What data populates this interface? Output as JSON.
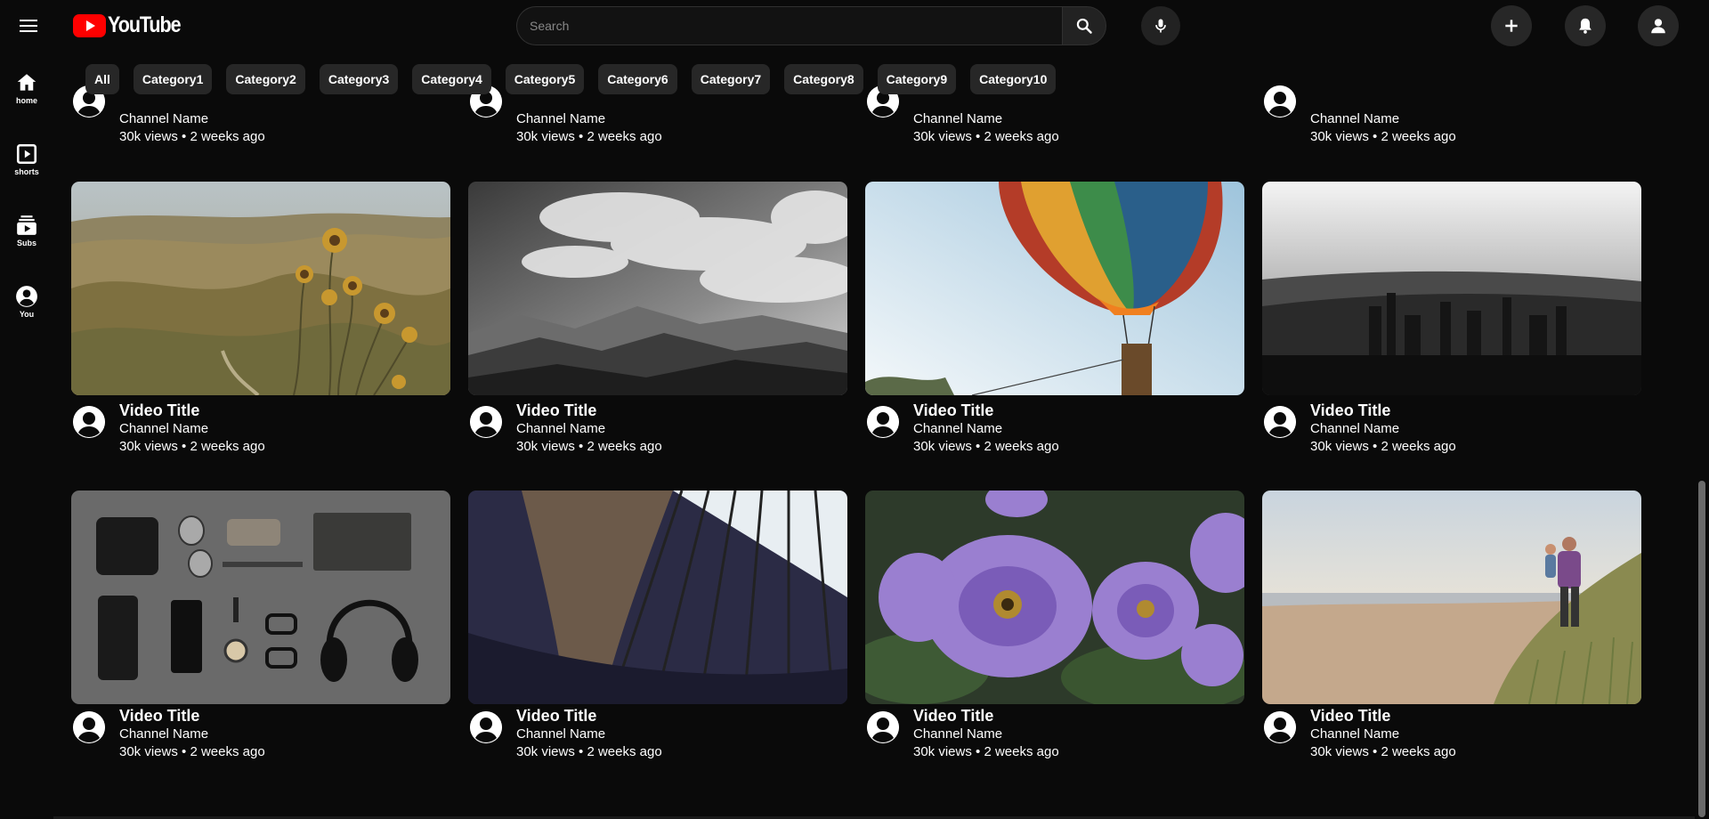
{
  "header": {
    "logo_text": "YouTube",
    "search_placeholder": "Search"
  },
  "chips": [
    "All",
    "Category1",
    "Category2",
    "Category3",
    "Category4",
    "Category5",
    "Category6",
    "Category7",
    "Category8",
    "Category9",
    "Category10"
  ],
  "sidebar": {
    "items": [
      {
        "label": "home",
        "icon": "home-icon"
      },
      {
        "label": "shorts",
        "icon": "shorts-icon"
      },
      {
        "label": "Subs",
        "icon": "subscriptions-icon"
      },
      {
        "label": "You",
        "icon": "account-icon"
      }
    ]
  },
  "videos": {
    "top_partial": [
      {
        "channel": "Channel Name",
        "stats": "30k views • 2 weeks ago"
      },
      {
        "channel": "Channel Name",
        "stats": "30k views • 2 weeks ago"
      },
      {
        "channel": "Channel Name",
        "stats": "30k views • 2 weeks ago"
      },
      {
        "channel": "Channel Name",
        "stats": "30k views • 2 weeks ago"
      }
    ],
    "row1": [
      {
        "title": "Video Title",
        "channel": "Channel Name",
        "stats": "30k views • 2 weeks ago",
        "thumbnail": "mountain-thistle"
      },
      {
        "title": "Video Title",
        "channel": "Channel Name",
        "stats": "30k views • 2 weeks ago",
        "thumbnail": "bw-mountains-clouds"
      },
      {
        "title": "Video Title",
        "channel": "Channel Name",
        "stats": "30k views • 2 weeks ago",
        "thumbnail": "hot-air-balloon"
      },
      {
        "title": "Video Title",
        "channel": "Channel Name",
        "stats": "30k views • 2 weeks ago",
        "thumbnail": "bw-city-skyline"
      }
    ],
    "row2": [
      {
        "title": "Video Title",
        "channel": "Channel Name",
        "stats": "30k views • 2 weeks ago",
        "thumbnail": "flatlay-accessories"
      },
      {
        "title": "Video Title",
        "channel": "Channel Name",
        "stats": "30k views • 2 weeks ago",
        "thumbnail": "library-shelves"
      },
      {
        "title": "Video Title",
        "channel": "Channel Name",
        "stats": "30k views • 2 weeks ago",
        "thumbnail": "purple-petunias"
      },
      {
        "title": "Video Title",
        "channel": "Channel Name",
        "stats": "30k views • 2 weeks ago",
        "thumbnail": "beach-father-child"
      }
    ]
  },
  "colors": {
    "background": "#0a0a0a",
    "chip": "#272727",
    "brand": "#ff0000"
  }
}
